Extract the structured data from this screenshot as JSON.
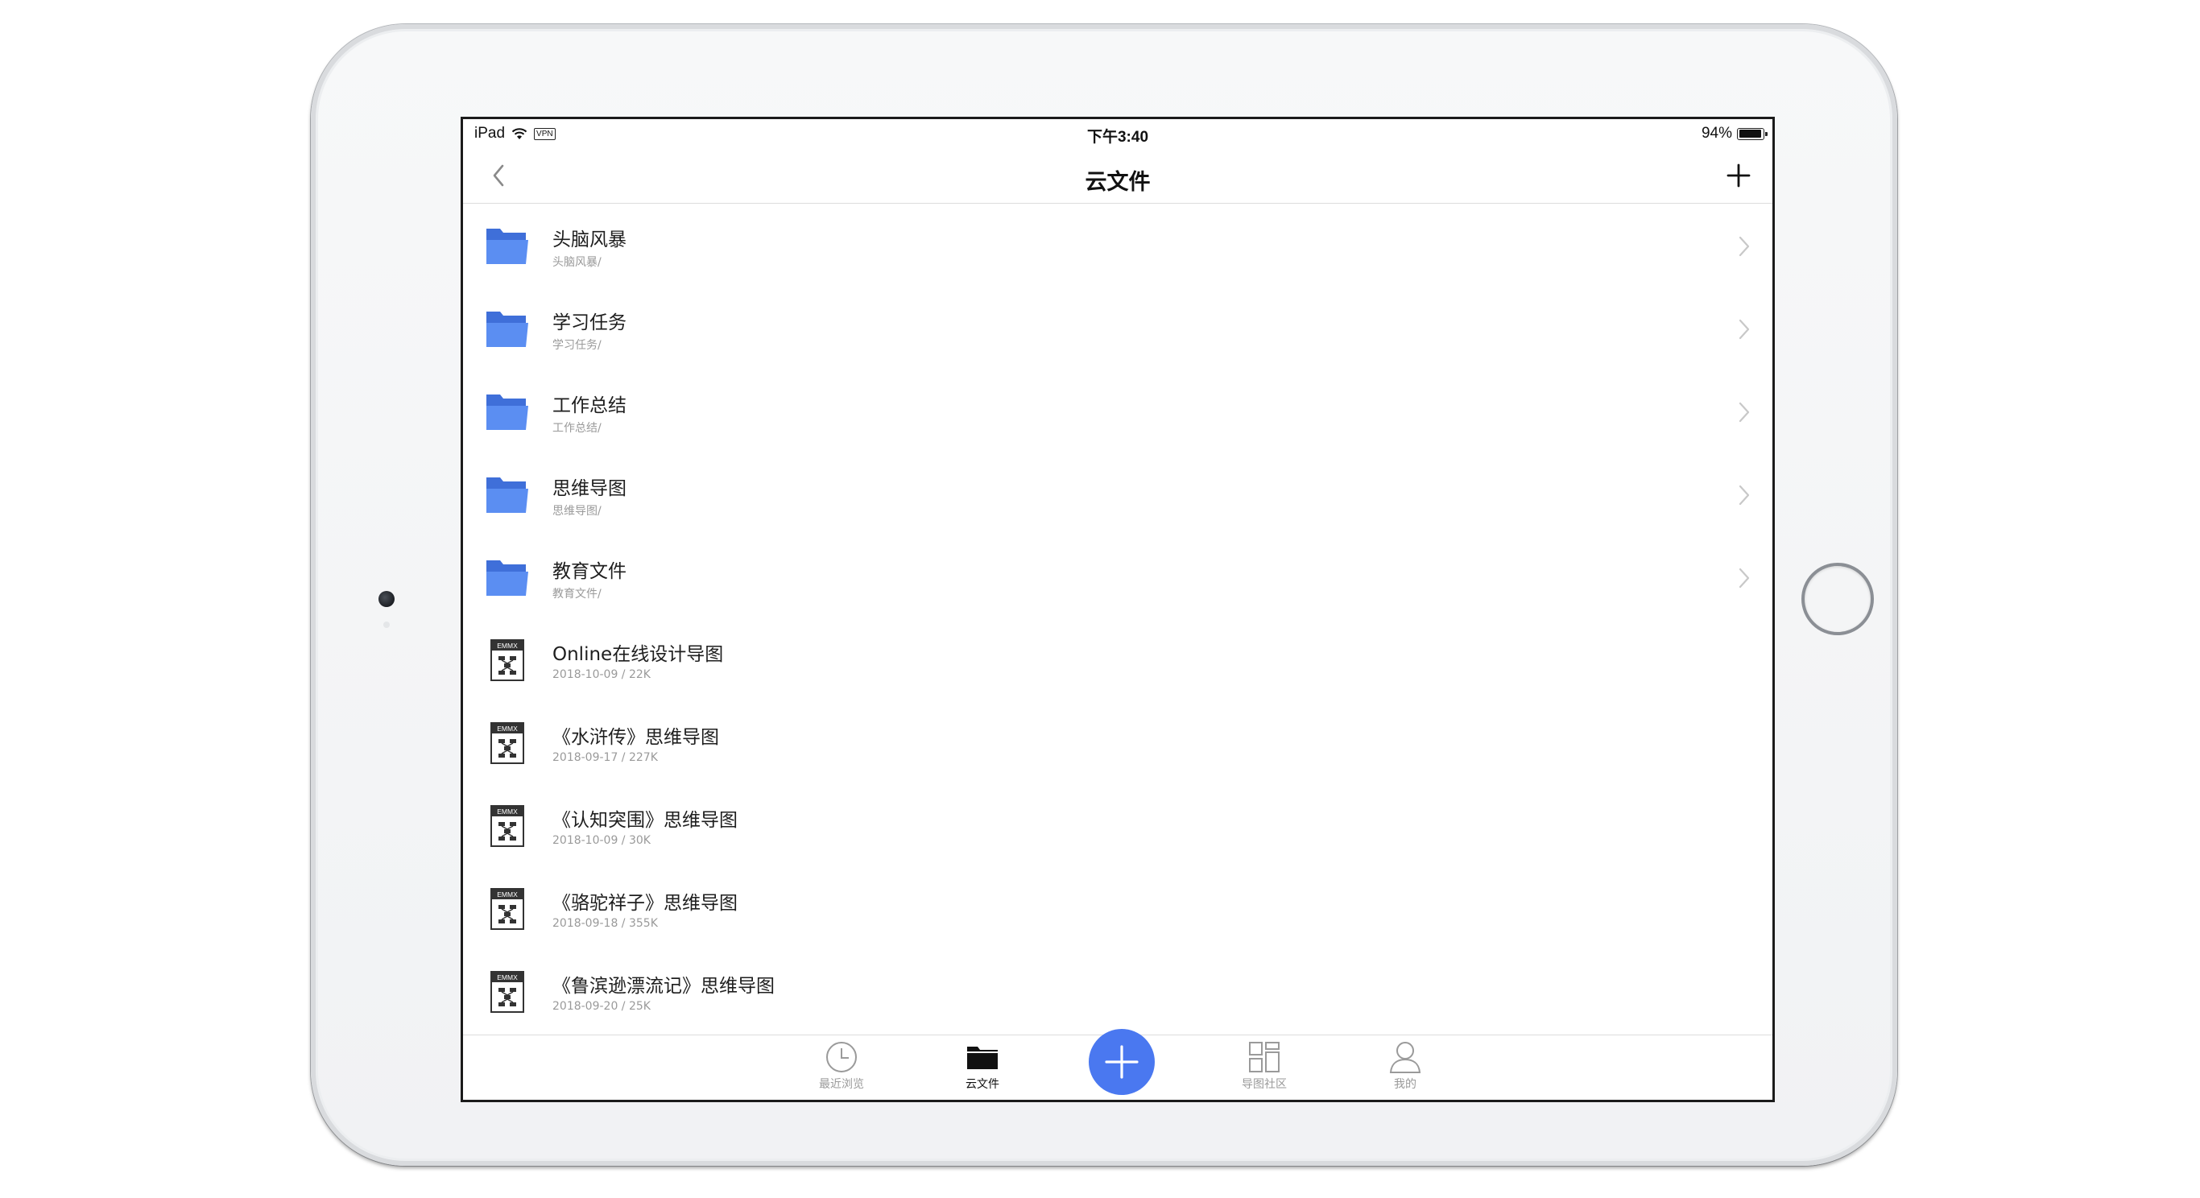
{
  "status_bar": {
    "device": "iPad",
    "vpn": "VPN",
    "time": "下午3:40",
    "battery": "94%",
    "battery_level": 0.94
  },
  "nav": {
    "title": "云文件",
    "back_icon": "chevron-left-icon",
    "add_icon": "plus-icon"
  },
  "items": [
    {
      "type": "folder",
      "title": "头脑风暴",
      "subtitle": "头脑风暴/"
    },
    {
      "type": "folder",
      "title": "学习任务",
      "subtitle": "学习任务/"
    },
    {
      "type": "folder",
      "title": "工作总结",
      "subtitle": "工作总结/"
    },
    {
      "type": "folder",
      "title": "思维导图",
      "subtitle": "思维导图/"
    },
    {
      "type": "folder",
      "title": "教育文件",
      "subtitle": "教育文件/"
    },
    {
      "type": "file",
      "title": "Online在线设计导图",
      "subtitle": "2018-10-09 / 22K",
      "badge": "EMMX"
    },
    {
      "type": "file",
      "title": "《水浒传》思维导图",
      "subtitle": "2018-09-17 / 227K",
      "badge": "EMMX"
    },
    {
      "type": "file",
      "title": "《认知突围》思维导图",
      "subtitle": "2018-10-09 / 30K",
      "badge": "EMMX"
    },
    {
      "type": "file",
      "title": "《骆驼祥子》思维导图",
      "subtitle": "2018-09-18 / 355K",
      "badge": "EMMX"
    },
    {
      "type": "file",
      "title": "《鲁滨逊漂流记》思维导图",
      "subtitle": "2018-09-20 / 25K",
      "badge": "EMMX"
    }
  ],
  "tabs": [
    {
      "label": "最近浏览",
      "icon": "clock-icon",
      "active": false
    },
    {
      "label": "云文件",
      "icon": "folder-icon",
      "active": true
    },
    {
      "label": "",
      "icon": "plus-icon",
      "active": false
    },
    {
      "label": "导图社区",
      "icon": "grid-icon",
      "active": false
    },
    {
      "label": "我的",
      "icon": "person-icon",
      "active": false
    }
  ],
  "colors": {
    "accent": "#4a78f0",
    "folder": "#5b8ef2",
    "folder_dark": "#3f6fd9",
    "subtext": "#9a9a9a"
  }
}
